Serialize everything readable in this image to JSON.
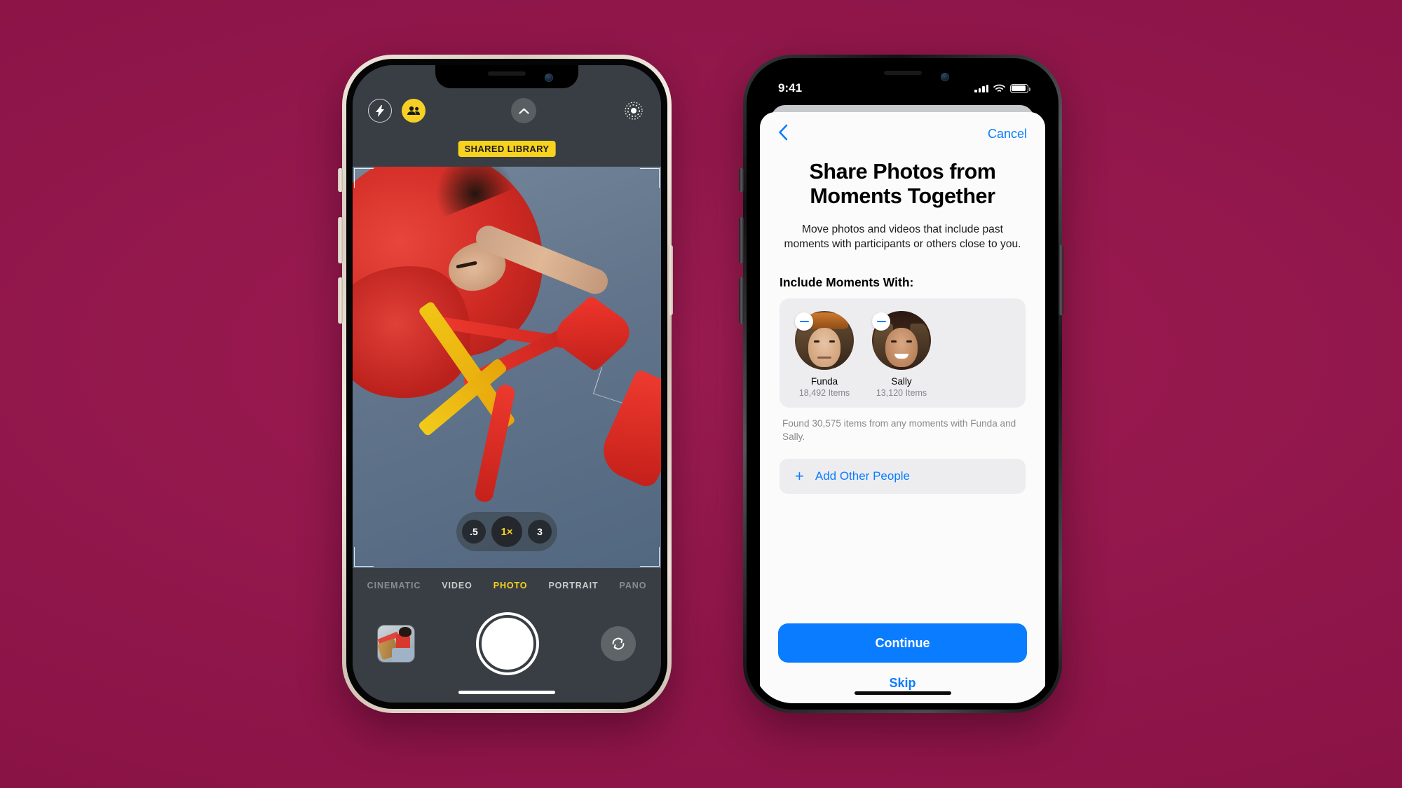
{
  "background": {
    "color": "#95174A"
  },
  "left_phone": {
    "frame_color": "#e3d8cb",
    "camera": {
      "top_controls": {
        "flash_icon": "flash-icon",
        "shared_library_icon": "people-icon",
        "chevron_icon": "chevron-up-icon",
        "live_photo_icon": "live-photo-icon"
      },
      "shared_badge": "SHARED LIBRARY",
      "zoom": {
        "options": [
          {
            "label": ".5",
            "active": false
          },
          {
            "label": "1×",
            "active": true
          },
          {
            "label": "3",
            "active": false
          }
        ]
      },
      "modes": [
        {
          "label": "CINEMATIC",
          "active": false
        },
        {
          "label": "VIDEO",
          "active": false
        },
        {
          "label": "PHOTO",
          "active": true
        },
        {
          "label": "PORTRAIT",
          "active": false
        },
        {
          "label": "PANO",
          "active": false
        }
      ],
      "bottom_controls": {
        "thumbnail": "last-photo-thumbnail",
        "shutter": "shutter-button",
        "flip_icon": "camera-flip-icon"
      }
    }
  },
  "right_phone": {
    "frame_color": "#1b1b1d",
    "status_bar": {
      "time": "9:41",
      "cellular_icon": "cellular-signal-icon",
      "wifi_icon": "wifi-icon",
      "battery_icon": "battery-icon"
    },
    "sheet": {
      "back_icon": "chevron-left-icon",
      "cancel_label": "Cancel",
      "title": "Share Photos from Moments Together",
      "subtitle": "Move photos and videos that include past moments with participants or others close to you.",
      "section_label": "Include Moments With:",
      "people": [
        {
          "name": "Funda",
          "items": "18,492 Items",
          "remove_icon": "minus-badge-icon"
        },
        {
          "name": "Sally",
          "items": "13,120 Items",
          "remove_icon": "minus-badge-icon"
        }
      ],
      "found_text": "Found 30,575 items from any moments with Funda and Sally.",
      "add_people_label": "Add Other People",
      "add_people_icon": "plus-icon",
      "continue_label": "Continue",
      "skip_label": "Skip",
      "accent_color": "#0a7cff"
    }
  }
}
